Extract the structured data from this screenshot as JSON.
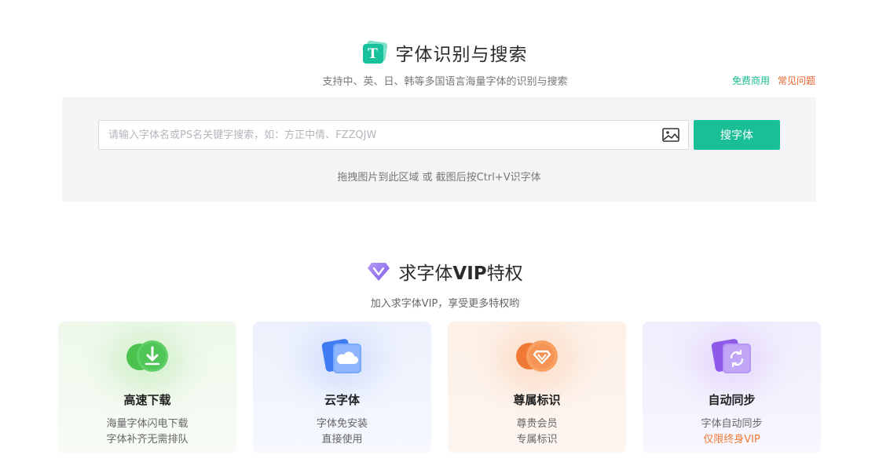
{
  "header": {
    "title": "字体识别与搜索",
    "subtitle": "支持中、英、日、韩等多国语言海量字体的识别与搜索",
    "logo_letter": "T",
    "links": {
      "free_commercial": "免费商用",
      "faq": "常见问题"
    }
  },
  "search": {
    "placeholder": "请输入字体名或PS名关键字搜索，如：方正中倩、FZZQJW",
    "value": "",
    "button_label": "搜字体",
    "drop_hint": "拖拽图片到此区域 或 截图后按Ctrl+V识字体"
  },
  "vip": {
    "title_prefix": "求字体",
    "title_bold": "VIP",
    "title_suffix": "特权",
    "subtitle": "加入求字体VIP，享受更多特权哟",
    "cards": [
      {
        "title": "高速下载",
        "line1": "海量字体闪电下载",
        "line2": "字体补齐无需排队"
      },
      {
        "title": "云字体",
        "line1": "字体免安装",
        "line2": "直接使用"
      },
      {
        "title": "尊属标识",
        "line1": "尊贵会员",
        "line2": "专属标识"
      },
      {
        "title": "自动同步",
        "line1": "字体自动同步",
        "line2": "仅限终身VIP"
      }
    ]
  },
  "colors": {
    "brand_green": "#1abf96",
    "link_green": "#17b890",
    "link_orange": "#e8612c",
    "accent_orange": "#f07a35"
  }
}
